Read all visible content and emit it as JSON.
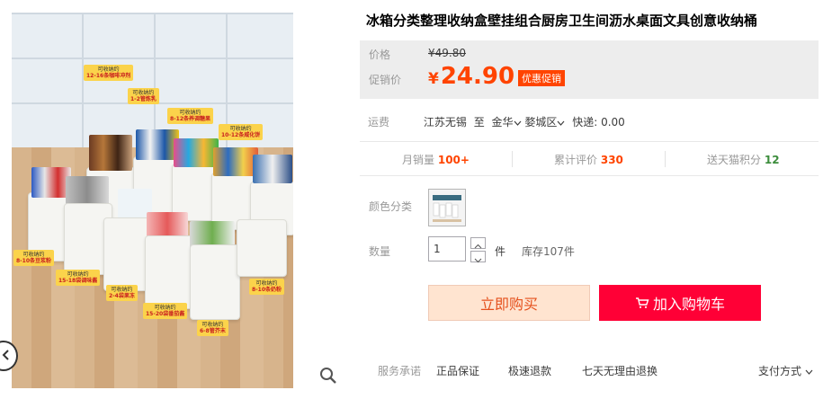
{
  "product": {
    "title": "冰箱分类整理收纳盒壁挂组合厨房卫生间沥水桌面文具创意收纳桶"
  },
  "gallery": {
    "tags": [
      {
        "top": "可收纳约",
        "bottom": "12-16条咖啡冲剂"
      },
      {
        "top": "可收纳约",
        "bottom": "1-2管炼乳"
      },
      {
        "top": "可收纳约",
        "bottom": "8-12条养调糖果"
      },
      {
        "top": "可收纳约",
        "bottom": "10-12条威化饼"
      },
      {
        "top": "可收纳约",
        "bottom": "8-10条豆浆粉"
      },
      {
        "top": "可收纳约",
        "bottom": "15-18袋调味酱"
      },
      {
        "top": "可收纳约",
        "bottom": "2-4袋果冻"
      },
      {
        "top": "可收纳约",
        "bottom": "15-20袋番茄酱"
      },
      {
        "top": "可收纳约",
        "bottom": "6-8管芥末"
      },
      {
        "top": "可收纳约",
        "bottom": "8-10条奶粉"
      }
    ]
  },
  "price": {
    "price_label": "价格",
    "original_price": "¥49.80",
    "promo_label": "促销价",
    "currency": "¥",
    "promo_price": "24.90",
    "promo_badge": "优惠促销"
  },
  "shipping": {
    "label": "运费",
    "origin": "江苏无锡",
    "to": "至",
    "destination": "金华",
    "district": "婺城区",
    "fee": "快递: 0.00"
  },
  "stats": {
    "monthly_sales_label": "月销量",
    "monthly_sales": "100+",
    "reviews_label": "累计评价",
    "reviews": "330",
    "points_label": "送天猫积分",
    "points": "12"
  },
  "options": {
    "color_label": "颜色分类",
    "quantity_label": "数量",
    "quantity_value": "1",
    "unit": "件",
    "stock": "库存107件"
  },
  "actions": {
    "buy_now": "立即购买",
    "add_cart": "加入购物车"
  },
  "service": {
    "label": "服务承诺",
    "items": [
      "正品保证",
      "极速退款",
      "七天无理由退换"
    ],
    "payment": "支付方式"
  },
  "colors": {
    "promo_orange": "#ff4400",
    "cart_red": "#ff0036",
    "buy_bg": "#ffe4d0"
  }
}
